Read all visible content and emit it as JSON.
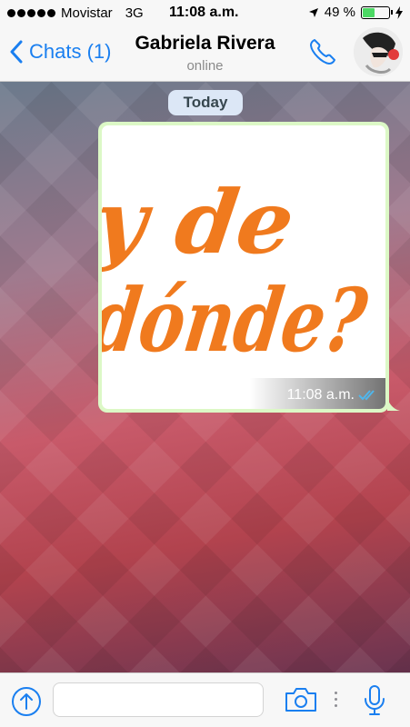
{
  "status_bar": {
    "carrier": "Movistar",
    "network": "3G",
    "time": "11:08 a.m.",
    "battery_text": "49 %",
    "battery_level": 0.49,
    "signal_bars": 5
  },
  "nav": {
    "back_label": "Chats (1)",
    "contact_name": "Gabriela Rivera",
    "contact_status": "online"
  },
  "chat": {
    "date_label": "Today",
    "messages": [
      {
        "type": "image",
        "image_text_line1": "y de",
        "image_text_line2": "dónde?",
        "time": "11:08 a.m.",
        "status": "read"
      }
    ]
  },
  "input": {
    "placeholder": ""
  },
  "colors": {
    "accent": "#1a7ff0",
    "bubble_out": "#dcf8c6",
    "image_text": "#f07a1e",
    "read_ticks": "#4fb6ec",
    "battery": "#4cd964"
  }
}
